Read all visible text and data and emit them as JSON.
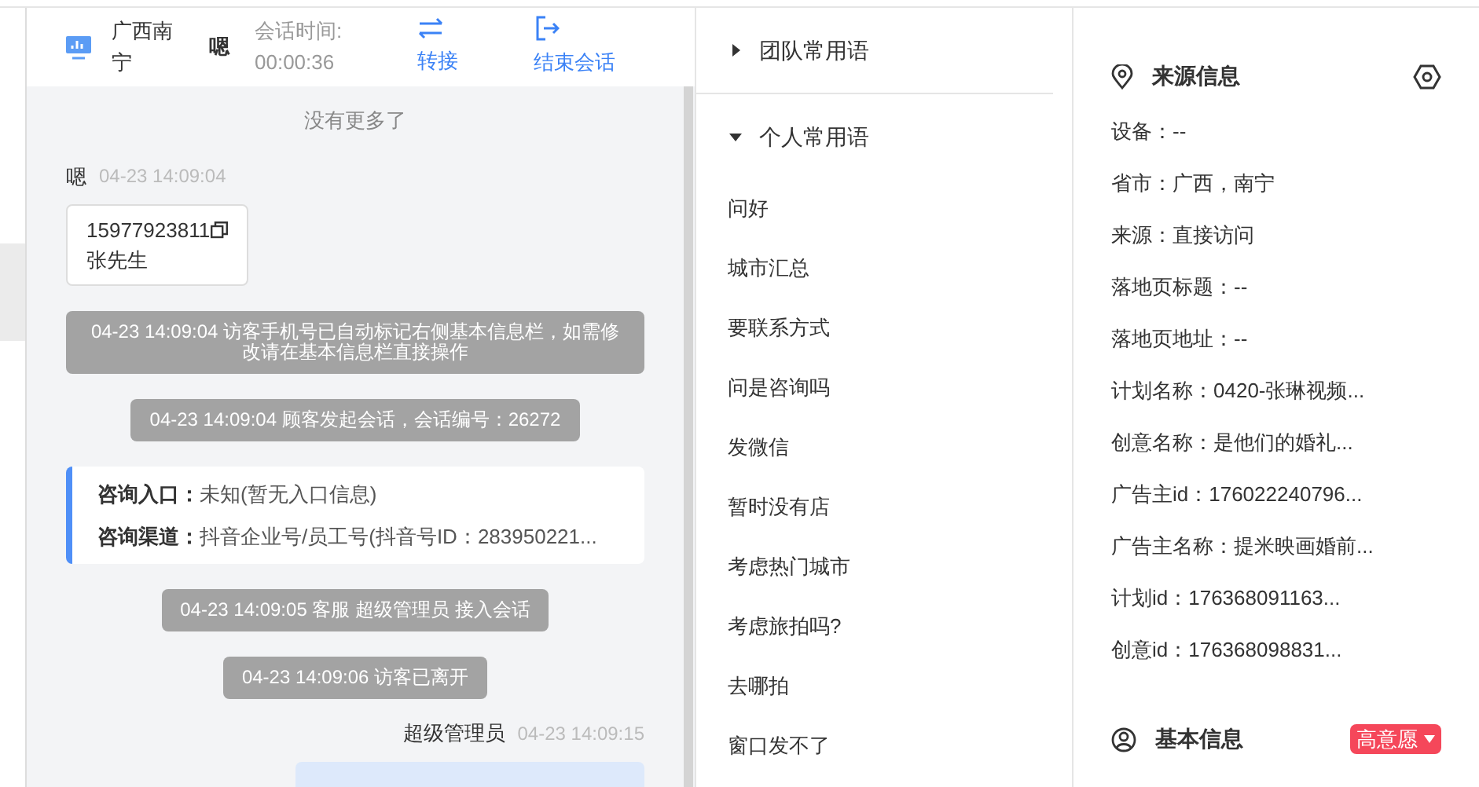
{
  "chat_header": {
    "location": "广西南宁",
    "visitor_name": "嗯",
    "session_time_label": "会话时间:",
    "session_time": "00:00:36",
    "actions": [
      {
        "kind": "transfer",
        "label": "转接"
      },
      {
        "kind": "end",
        "label": "结束会话"
      }
    ]
  },
  "chat": {
    "no_more": "没有更多了",
    "messages": [
      {
        "kind": "visitor",
        "sender": "嗯",
        "time": "04-23 14:09:04",
        "lines": [
          "15977923811",
          "张先生"
        ]
      },
      {
        "kind": "system",
        "text": "04-23 14:09:04 访客手机号已自动标记右侧基本信息栏，如需修改请在基本信息栏直接操作"
      },
      {
        "kind": "system",
        "text": "04-23 14:09:04 顾客发起会话，会话编号：26272"
      },
      {
        "kind": "info",
        "rows": [
          {
            "label": "咨询入口：",
            "value": "未知(暂无入口信息)"
          },
          {
            "label": "咨询渠道：",
            "value": "抖音企业号/员工号(抖音号ID：283950221..."
          }
        ]
      },
      {
        "kind": "system",
        "text": "04-23 14:09:05 客服 超级管理员 接入会话"
      },
      {
        "kind": "system",
        "text": "04-23 14:09:06 访客已离开"
      },
      {
        "kind": "agent",
        "sender": "超级管理员",
        "time": "04-23 14:09:15"
      }
    ]
  },
  "phrases": {
    "groups": [
      {
        "title": "团队常用语",
        "expanded": false
      },
      {
        "title": "个人常用语",
        "expanded": true,
        "items": [
          "问好",
          "城市汇总",
          "要联系方式",
          "问是咨询吗",
          "发微信",
          "暂时没有店",
          "考虑热门城市",
          "考虑旅拍吗?",
          "去哪拍",
          "窗口发不了"
        ]
      }
    ]
  },
  "source_info": {
    "title": "来源信息",
    "fields": [
      "设备：--",
      "省市：广西，南宁",
      "来源：直接访问",
      "落地页标题：--",
      "落地页地址：--",
      "计划名称：0420-张琳视频...",
      "创意名称：是他们的婚礼...",
      "广告主id：176022240796...",
      "广告主名称：提米映画婚前...",
      "计划id：176368091163...",
      "创意id：176368098831..."
    ]
  },
  "basic_info": {
    "title": "基本信息",
    "intent_tag": {
      "label": "高意愿",
      "color": "#f5475a"
    }
  }
}
